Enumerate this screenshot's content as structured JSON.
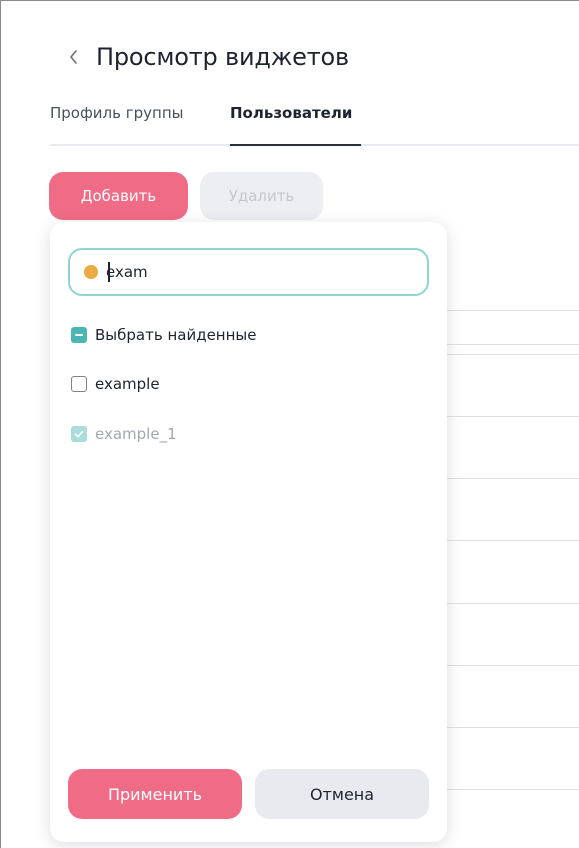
{
  "header": {
    "title": "Просмотр виджетов",
    "back_icon": "chevron-left-icon"
  },
  "tabs": [
    {
      "label": "Профиль группы",
      "active": false
    },
    {
      "label": "Пользователи",
      "active": true
    }
  ],
  "toolbar": {
    "add_label": "Добавить",
    "delete_label": "Удалить",
    "delete_disabled": true
  },
  "popup": {
    "search": {
      "value": "exam",
      "status_color": "#eeaa45"
    },
    "select_found": {
      "label": "Выбрать найденные",
      "state": "indeterminate"
    },
    "options": [
      {
        "label": "example",
        "checked": false,
        "disabled": false
      },
      {
        "label": "example_1",
        "checked": true,
        "disabled": true
      }
    ],
    "apply_label": "Применить",
    "cancel_label": "Отмена"
  },
  "colors": {
    "accent": "#f06c86",
    "teal": "#4cb6b4",
    "disabled_bg": "#edeef2"
  }
}
